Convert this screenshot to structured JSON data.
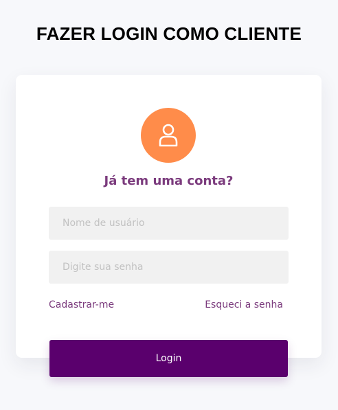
{
  "page": {
    "title": "FAZER LOGIN COMO CLIENTE"
  },
  "card": {
    "avatar_icon": "user-icon",
    "heading": "Já tem uma conta?",
    "username_placeholder": "Nome de usuário",
    "password_placeholder": "Digite sua senha",
    "register_link": "Cadastrar-me",
    "forgot_link": "Esqueci a senha",
    "login_button": "Login"
  },
  "colors": {
    "background": "#f7f8fb",
    "avatar": "#ff8c4a",
    "accent_text": "#7b3b7d",
    "button": "#5a006d",
    "field": "#f1f1f1"
  }
}
